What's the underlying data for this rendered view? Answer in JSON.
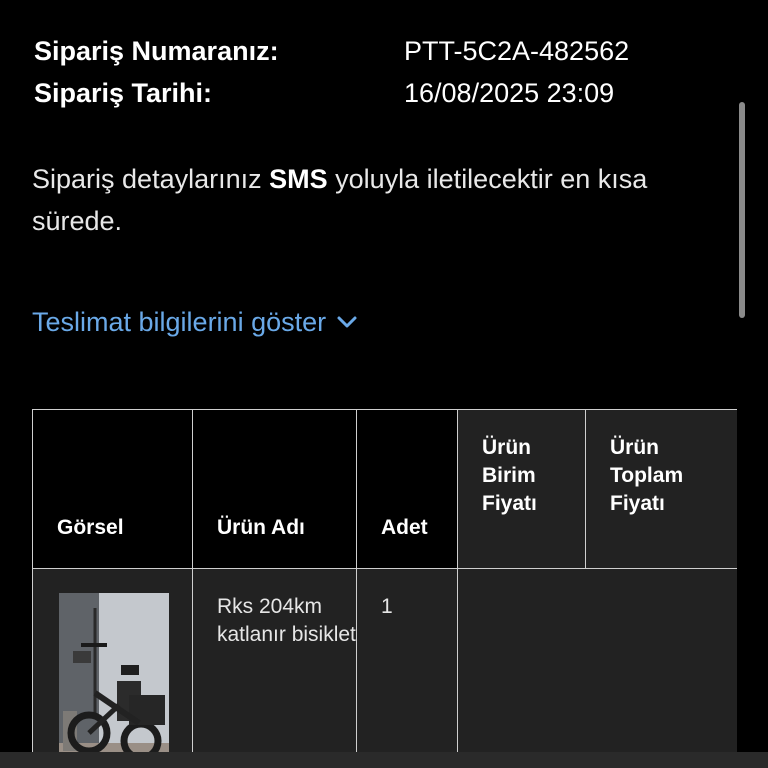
{
  "order": {
    "number_label": "Sipariş Numaranız:",
    "number_value": "PTT-5C2A-482562",
    "date_label": "Sipariş Tarihi:",
    "date_value": "16/08/2025 23:09"
  },
  "message": {
    "before": "Sipariş detaylarınız ",
    "bold": "SMS",
    "after": " yoluyla iletilecektir en kısa sürede."
  },
  "delivery_link": {
    "label": "Teslimat bilgilerini göster",
    "icon": "chevron-down-icon",
    "color": "#6aa9e8"
  },
  "table": {
    "headers": {
      "image": "Görsel",
      "name": "Ürün Adı",
      "qty": "Adet",
      "unit_price": "Ürün Birim Fiyatı",
      "total_price": "Ürün Toplam Fiyatı"
    },
    "rows": [
      {
        "image_alt": "bicycle-photo",
        "name": "Rks 204km katlanır bisiklet",
        "qty": "1",
        "unit_price": "",
        "total_price": ""
      }
    ]
  },
  "colors": {
    "background": "#000000",
    "cell_dark": "#222222",
    "link": "#6aa9e8",
    "border": "#cfcfcf"
  }
}
